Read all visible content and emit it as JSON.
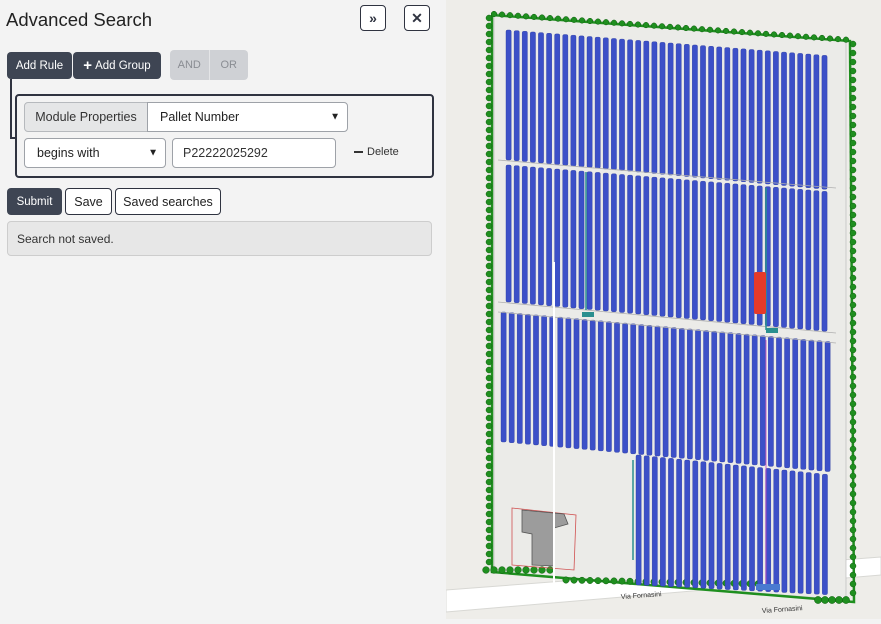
{
  "panel": {
    "title": "Advanced Search",
    "collapse_button": "»",
    "close_button": "✕"
  },
  "query_builder": {
    "add_rule_label": "Add Rule",
    "add_group_label": "Add Group",
    "add_group_icon": "+",
    "logic_and_label": "AND",
    "logic_or_label": "OR",
    "rule": {
      "category_label": "Module Properties",
      "field_value": "Pallet Number",
      "operator_value": "begins with",
      "value": "P22222025292",
      "delete_label": "Delete"
    }
  },
  "actions": {
    "submit_label": "Submit",
    "save_label": "Save",
    "saved_searches_label": "Saved searches"
  },
  "status": {
    "message": "Search not saved."
  },
  "map": {
    "street_label_1": "Via Fornasini",
    "street_label_2": "Via Fornasini"
  },
  "colors": {
    "primary_dark": "#3e4553",
    "panel_bg": "#f3f3f3",
    "solar_panel_blue": "#3c50c8",
    "tree_green": "#1f8f1f",
    "inverter_red": "#e53a2a"
  }
}
